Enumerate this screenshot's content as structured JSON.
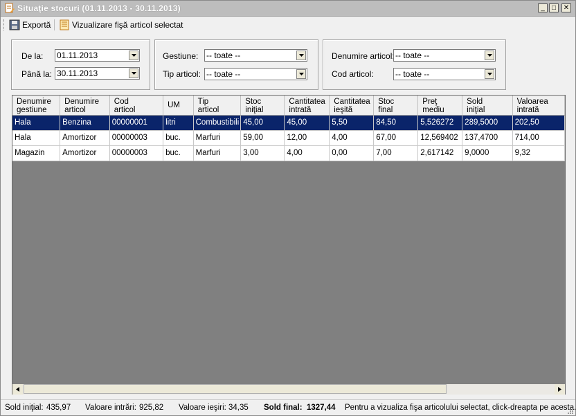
{
  "window": {
    "title": "Situaţie stocuri (01.11.2013 - 30.11.2013)",
    "minimize": "_",
    "maximize": "□",
    "close": "✕"
  },
  "toolbar": {
    "export_label": "Exportă",
    "view_sheet_label": "Vizualizare fişă articol selectat"
  },
  "filters": {
    "from_label": "De la:",
    "from_value": "01.11.2013",
    "to_label": "Până la:",
    "to_value": "30.11.2013",
    "gestiune_label": "Gestiune:",
    "gestiune_value": "-- toate --",
    "tip_label": "Tip articol:",
    "tip_value": "-- toate --",
    "denumire_label": "Denumire articol:",
    "denumire_value": "-- toate --",
    "cod_label": "Cod articol:",
    "cod_value": "-- toate --"
  },
  "grid": {
    "columns": [
      [
        "Denumire",
        "gestiune"
      ],
      [
        "Denumire",
        "articol"
      ],
      [
        "Cod",
        "articol"
      ],
      [
        "UM",
        ""
      ],
      [
        "Tip",
        "articol"
      ],
      [
        "Stoc",
        "iniţial"
      ],
      [
        "Cantitatea",
        "intrată"
      ],
      [
        "Cantitatea",
        "ieşită"
      ],
      [
        "Stoc",
        "final"
      ],
      [
        "Preţ",
        "mediu"
      ],
      [
        "Sold",
        "iniţial"
      ],
      [
        "Valoarea",
        "intrată"
      ]
    ],
    "rows": [
      [
        "Hala",
        "Benzina",
        "00000001",
        "litri",
        "Combustibili",
        "45,00",
        "45,00",
        "5,50",
        "84,50",
        "5,526272",
        "289,5000",
        "202,50"
      ],
      [
        "Hala",
        "Amortizor",
        "00000003",
        "buc.",
        "Marfuri",
        "59,00",
        "12,00",
        "4,00",
        "67,00",
        "12,569402",
        "137,4700",
        "714,00"
      ],
      [
        "Magazin",
        "Amortizor",
        "00000003",
        "buc.",
        "Marfuri",
        "3,00",
        "4,00",
        "0,00",
        "7,00",
        "2,617142",
        "9,0000",
        "9,32"
      ]
    ],
    "selected_row": 0
  },
  "status": {
    "sold_initial_label": "Sold iniţial:",
    "sold_initial_value": "435,97",
    "valoare_intrari_label": "Valoare intrări:",
    "valoare_intrari_value": "925,82",
    "valoare_iesiri_label": "Valoare ieşiri:",
    "valoare_iesiri_value": "34,35",
    "sold_final_label": "Sold final:",
    "sold_final_value": "1327,44",
    "hint": "Pentru a vizualiza fişa articolului selectat, click-dreapta pe acesta."
  },
  "colors": {
    "selection": "#0a246a",
    "grid_empty": "#808080",
    "title_bar": "#bdbdbd"
  }
}
